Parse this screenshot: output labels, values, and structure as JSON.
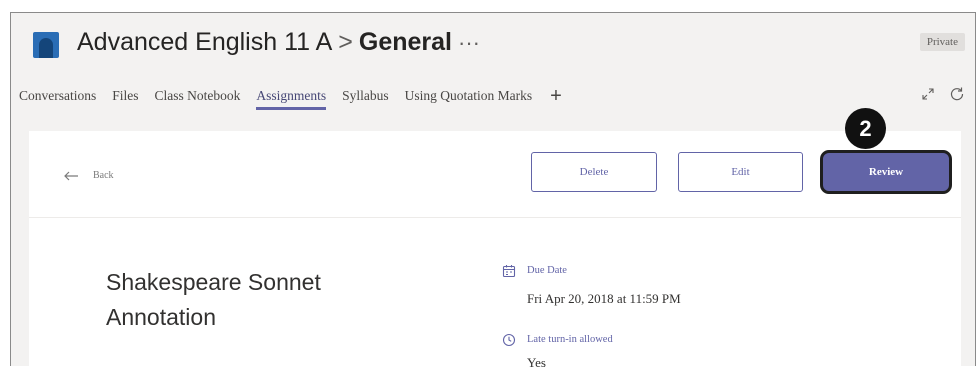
{
  "header": {
    "team_name": "Advanced English 11 A",
    "separator": ">",
    "channel_name": "General",
    "more": "···",
    "privacy_badge": "Private"
  },
  "tabs": [
    {
      "label": "Conversations",
      "active": false
    },
    {
      "label": "Files",
      "active": false
    },
    {
      "label": "Class Notebook",
      "active": false
    },
    {
      "label": "Assignments",
      "active": true
    },
    {
      "label": "Syllabus",
      "active": false
    },
    {
      "label": "Using Quotation Marks",
      "active": false
    }
  ],
  "tab_add": "+",
  "icons": {
    "team_avatar": "team-avatar-icon",
    "expand": "expand-icon",
    "refresh": "refresh-icon",
    "back": "arrow-left-icon",
    "due_date": "calendar-icon",
    "late": "clock-icon"
  },
  "command_bar": {
    "back_label": "Back",
    "delete_label": "Delete",
    "edit_label": "Edit",
    "review_label": "Review"
  },
  "callout_number": "2",
  "assignment": {
    "title": "Shakespeare Sonnet Annotation",
    "due_label": "Due Date",
    "due_value": "Fri Apr 20, 2018 at 11:59 PM",
    "late_label": "Late turn-in allowed",
    "late_value": "Yes"
  },
  "colors": {
    "accent": "#6264a7",
    "header_bg": "#f3f2f1",
    "callout": "#111111"
  }
}
